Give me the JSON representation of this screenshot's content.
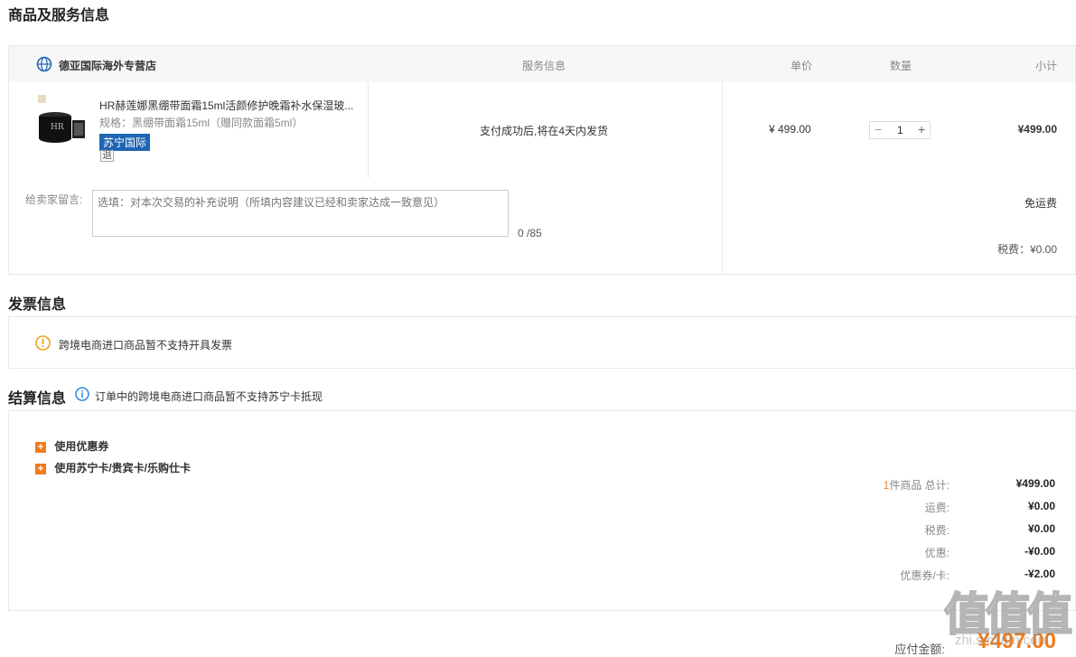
{
  "product_section": {
    "title": "商品及服务信息",
    "store_name": "德亚国际海外专营店",
    "columns": {
      "service": "服务信息",
      "unit_price": "单价",
      "quantity": "数量",
      "subtotal": "小计"
    },
    "item": {
      "name": "HR赫莲娜黑绷带面霜15ml活颜修护晚霜补水保湿玻...",
      "spec": "规格：黑绷带面霜15ml（赠同款面霜5ml）",
      "badge": "苏宁国际",
      "return_tag": "退",
      "service_info": "支付成功后,将在4天内发货",
      "unit_price": "¥ 499.00",
      "quantity": "1",
      "qty_minus": "−",
      "qty_plus": "+",
      "subtotal": "¥499.00"
    },
    "message": {
      "label": "给卖家留言:",
      "placeholder": "选填：对本次交易的补充说明（所填内容建议已经和卖家达成一致意见）",
      "counter": "0 /85"
    },
    "shipping": "免运费",
    "tax": "税费：¥0.00"
  },
  "invoice_section": {
    "title": "发票信息",
    "notice": "跨境电商进口商品暂不支持开具发票"
  },
  "settlement_section": {
    "title": "结算信息",
    "info_note": "订单中的跨境电商进口商品暂不支持苏宁卡抵现",
    "options": [
      "使用优惠券",
      "使用苏宁卡/贵宾卡/乐购仕卡"
    ],
    "summary": {
      "count_prefix": "1",
      "total_label": "件商品 总计:",
      "total_value": "¥499.00",
      "freight_label": "运费:",
      "freight_value": "¥0.00",
      "tax_label": "税费:",
      "tax_value": "¥0.00",
      "discount_label": "优惠:",
      "discount_value": "-¥0.00",
      "coupon_label": "优惠券/卡:",
      "coupon_value": "-¥2.00"
    },
    "payable_label": "应付金额:",
    "payable_value": "¥497.00"
  },
  "watermark": {
    "text": "值值值",
    "sub": "zhi.smzdm.com"
  },
  "colors": {
    "accent": "#f07c1c",
    "badge_blue": "#1e64b4",
    "info_blue": "#2b8ae6",
    "warn": "#f0a020"
  }
}
